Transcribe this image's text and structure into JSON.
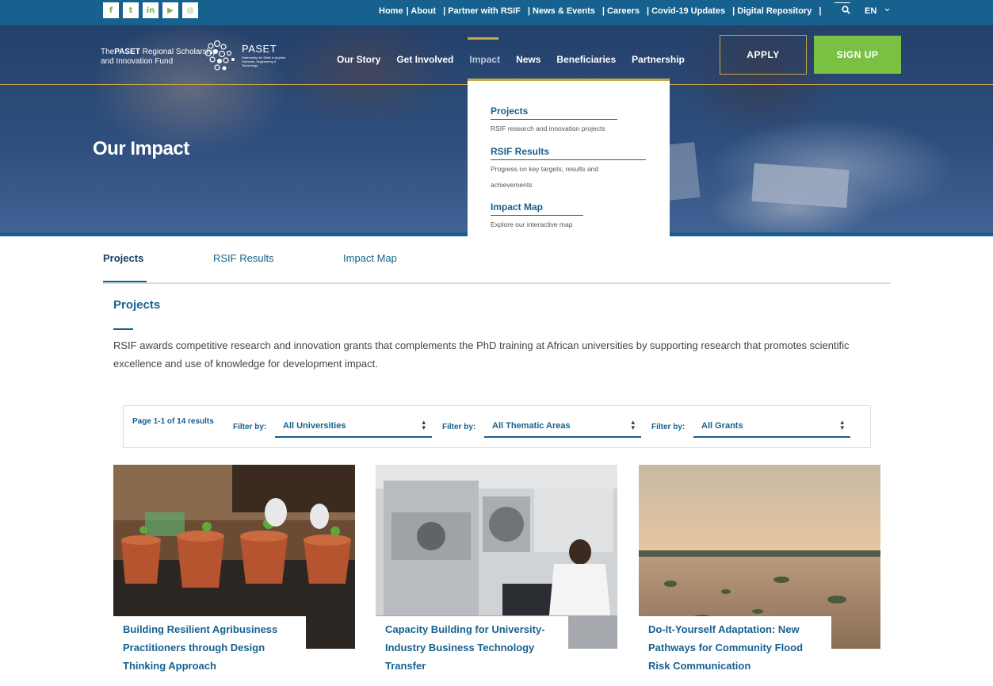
{
  "topbar": {
    "social": [
      {
        "icon": "facebook-icon",
        "glyph": "f"
      },
      {
        "icon": "twitter-icon",
        "glyph": "t"
      },
      {
        "icon": "linkedin-icon",
        "glyph": "in"
      },
      {
        "icon": "youtube-icon",
        "glyph": "▶"
      },
      {
        "icon": "instagram-icon",
        "glyph": "◎"
      }
    ],
    "links": [
      "Home",
      "| About",
      "| Partner with RSIF",
      "| News & Events",
      "| Careers",
      "| Covid-19 Updates",
      "| Digital Repository",
      "|"
    ],
    "language": "EN"
  },
  "header": {
    "logo_line1_prefix": "The",
    "logo_line1_bold": "PASET",
    "logo_line1_suffix": "Regional Scholarship",
    "logo_line2": "and Innovation Fund",
    "logo_paset": "PASET",
    "logo_paset_sub": "Partnership for Skills in Applied Sciences, Engineering & Technology",
    "nav": [
      "Our Story",
      "Get Involved",
      "Impact",
      "News",
      "Beneficiaries",
      "Partnership"
    ],
    "apply_label": "APPLY",
    "signup_label": "SIGN UP"
  },
  "hero": {
    "title": "Our Impact"
  },
  "dropdown": {
    "items": [
      {
        "title": "Projects",
        "desc": "RSIF research and innovation projects"
      },
      {
        "title": "RSIF Results",
        "desc": "Progress on key targets; results and achievements"
      },
      {
        "title": "Impact Map",
        "desc": "Explore our interactive map"
      }
    ]
  },
  "tabs": [
    "Projects",
    "RSIF Results",
    "Impact Map"
  ],
  "section": {
    "title": "Projects",
    "text": "RSIF awards competitive research and innovation grants that complements the PhD training at African universities by supporting research that promotes scientific excellence and use of knowledge for development impact."
  },
  "filters": {
    "results": "Page 1-1 of 14 results",
    "label": "Filter by:",
    "universities": "All Universities",
    "thematic": "All Thematic Areas",
    "grants": "All Grants"
  },
  "cards": [
    {
      "title": "Building Resilient Agribusiness Practitioners through Design Thinking Approach"
    },
    {
      "title": "Capacity Building for University-Industry Business Technology Transfer"
    },
    {
      "title": "Do-It-Yourself Adaptation: New Pathways for Community Flood Risk Communication"
    }
  ],
  "colors": {
    "brand_blue": "#17618f",
    "accent_green": "#7ac143",
    "accent_gold": "#c8a84a"
  }
}
